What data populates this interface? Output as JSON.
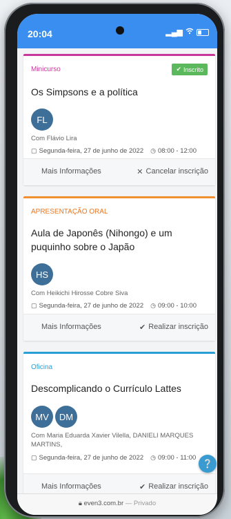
{
  "status_bar": {
    "time": "20:04",
    "signal_icon": "signal-icon",
    "wifi_icon": "wifi-icon",
    "battery_icon": "battery-icon"
  },
  "events": [
    {
      "type": "Minicurso",
      "type_color": "#c8389b",
      "accent_color": "#c8389b",
      "badge": "Inscrito",
      "title": "Os Simpsons e a política",
      "avatars": [
        "FL"
      ],
      "speaker": "Com Flávio Lira",
      "date": "Segunda-feira, 27 de junho de 2022",
      "time": "08:00 - 12:00",
      "more_info": "Mais Informações",
      "action_label": "Cancelar inscrição",
      "action_icon": "close-icon"
    },
    {
      "type": "APRESENTAÇÃO ORAL",
      "type_color": "#e87722",
      "accent_color": "#f0902e",
      "title": "Aula de Japonês (Nihongo) e um puquinho sobre o Japão",
      "avatars": [
        "HS"
      ],
      "speaker": "Com Heikichi Hirosse Cobre Siva",
      "date": "Segunda-feira, 27 de junho de 2022",
      "time": "09:00 - 10:00",
      "more_info": "Mais Informações",
      "action_label": "Realizar inscrição",
      "action_icon": "check-icon"
    },
    {
      "type": "Oficina",
      "type_color": "#2a9fd6",
      "accent_color": "#2a9fd6",
      "title": "Descomplicando o Currículo Lattes",
      "avatars": [
        "MV",
        "DM"
      ],
      "speaker": "Com Maria Eduarda Xavier Vilella, DANIELI MARQUES MARTINS,",
      "date": "Segunda-feira, 27 de junho de 2022",
      "time": "09:00 - 11:00",
      "more_info": "Mais Informações",
      "action_label": "Realizar inscrição",
      "action_icon": "check-icon"
    }
  ],
  "browser": {
    "url": "even3.com.br",
    "separator": "—",
    "mode": "Privado",
    "lock_icon": "lock-icon"
  },
  "chat_button_icon": "chat-icon"
}
